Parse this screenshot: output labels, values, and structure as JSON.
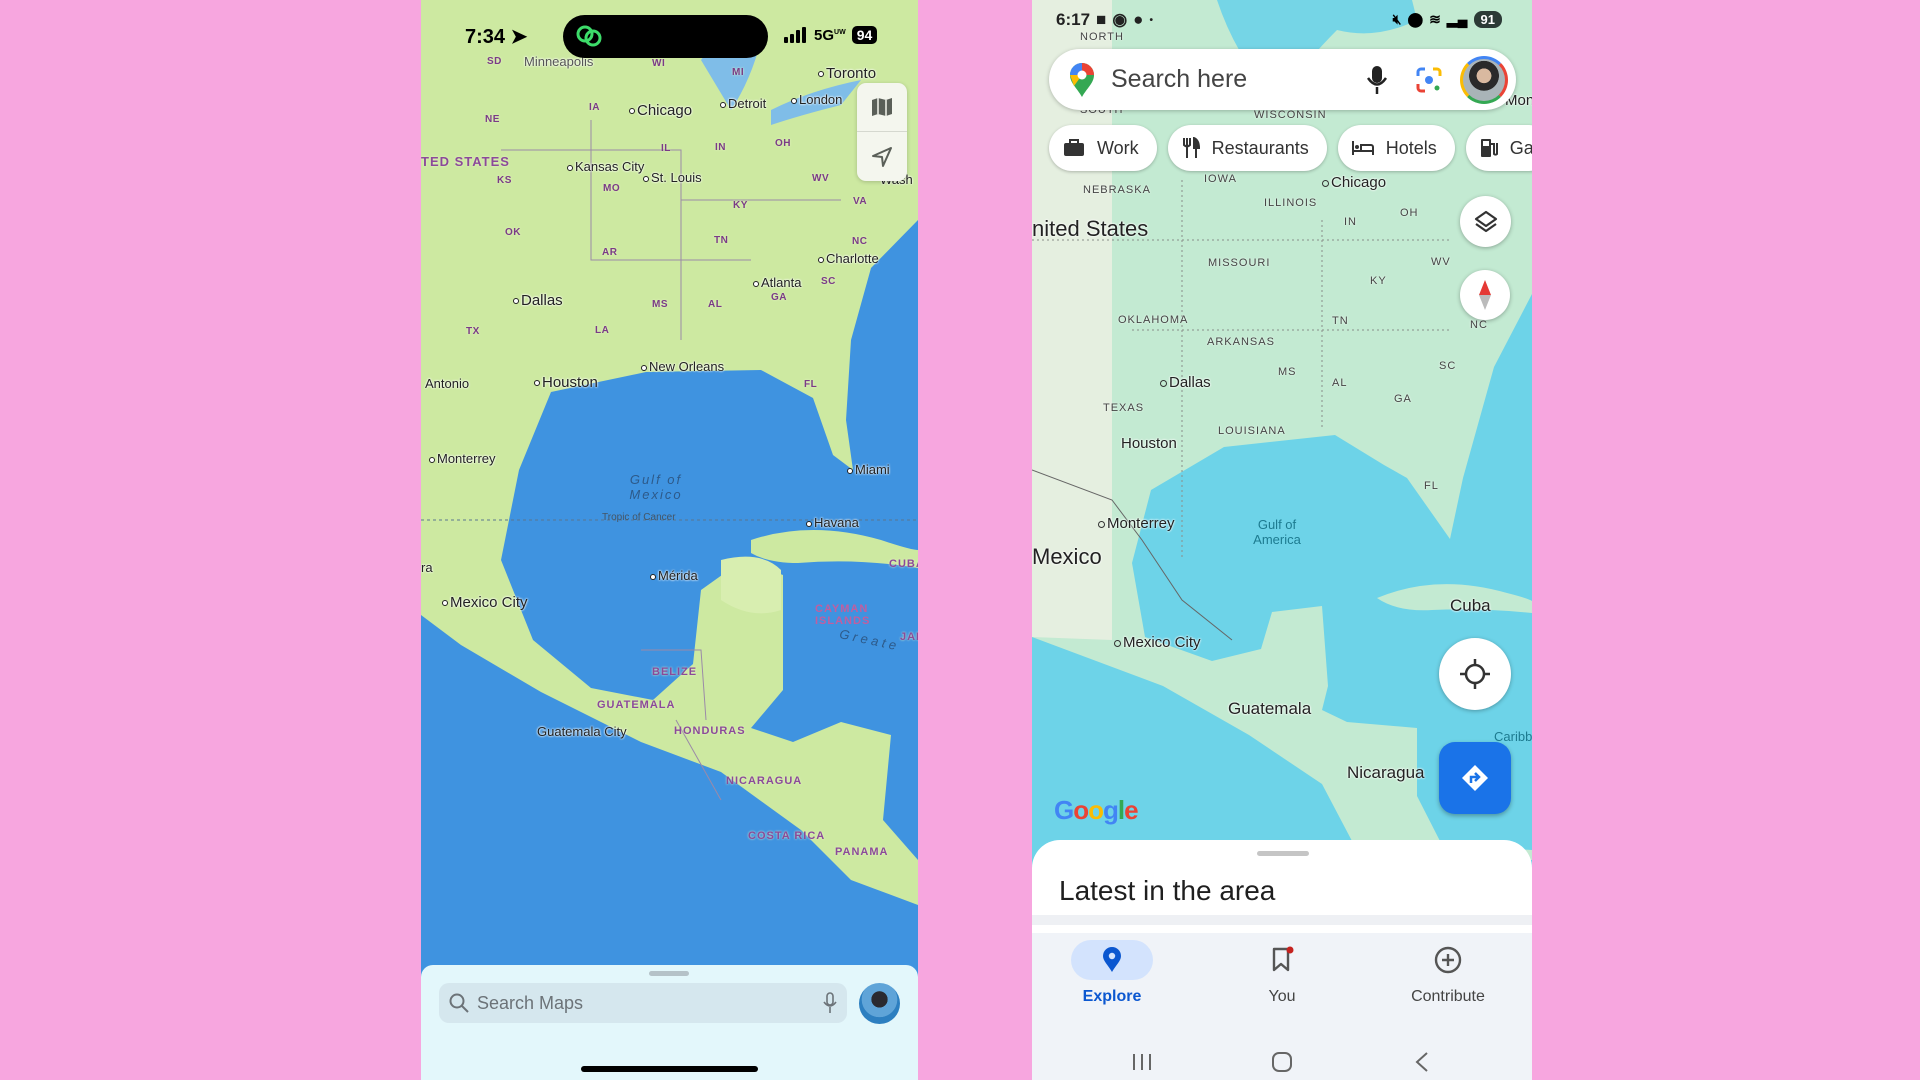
{
  "apple_maps": {
    "status": {
      "time": "7:34",
      "network": "5G",
      "network_suffix": "UW",
      "battery": "94"
    },
    "controls": {
      "map_mode": "map-icon",
      "locate": "location-arrow-icon"
    },
    "labels": {
      "minneapolis": "Minneapolis",
      "sd": "SD",
      "wi": "WI",
      "mi": "MI",
      "toronto": "Toronto",
      "london": "London",
      "detroit": "Detroit",
      "chicago": "Chicago",
      "ia": "IA",
      "ne": "NE",
      "il": "IL",
      "in": "IN",
      "oh": "OH",
      "us": "TED STATES",
      "kansas_city": "Kansas City",
      "st_louis": "St. Louis",
      "ks": "KS",
      "mo": "MO",
      "wv": "WV",
      "wash": "Wash",
      "ky": "KY",
      "va": "VA",
      "ok": "OK",
      "tn": "TN",
      "nc": "NC",
      "charlotte": "Charlotte",
      "ar": "AR",
      "atlanta": "Atlanta",
      "sc": "SC",
      "ga": "GA",
      "dallas": "Dallas",
      "ms": "MS",
      "al": "AL",
      "tx": "TX",
      "la": "LA",
      "new_orleans": "New Orleans",
      "antonio": "Antonio",
      "houston": "Houston",
      "fl": "FL",
      "monterrey": "Monterrey",
      "miami": "Miami",
      "gulf1": "Gulf of",
      "gulf2": "Mexico",
      "tropic": "Tropic of Cancer",
      "havana": "Havana",
      "cuba": "CUBA",
      "ra": "ra",
      "merida": "Mérida",
      "mexico_city": "Mexico City",
      "cayman1": "CAYMAN",
      "cayman2": "ISLANDS",
      "greater": "G r e a t e",
      "jam": "JAM",
      "belize": "BELIZE",
      "guatemala": "GUATEMALA",
      "guatemala_city": "Guatemala City",
      "honduras": "HONDURAS",
      "nicaragua": "NICARAGUA",
      "costa_rica": "COSTA RICA",
      "panama": "PANAMA"
    },
    "search": {
      "placeholder": "Search Maps"
    }
  },
  "google_maps": {
    "status": {
      "time": "6:17",
      "battery": "91"
    },
    "search": {
      "placeholder": "Search here"
    },
    "chips": [
      {
        "label": "Work",
        "icon": "briefcase-icon"
      },
      {
        "label": "Restaurants",
        "icon": "fork-knife-icon"
      },
      {
        "label": "Hotels",
        "icon": "bed-icon"
      },
      {
        "label": "Ga",
        "icon": "gas-pump-icon"
      }
    ],
    "labels": {
      "north": "NORTH",
      "south": "SOUTH",
      "wisconsin": "WISCONSIN",
      "nebraska": "NEBRASKA",
      "iowa": "IOWA",
      "chicago": "Chicago",
      "illinois": "ILLINOIS",
      "in": "IN",
      "oh": "OH",
      "us": "nited States",
      "wv": "WV",
      "missouri": "MISSOURI",
      "ky": "KY",
      "oklahoma": "OKLAHOMA",
      "tn": "TN",
      "nc": "NC",
      "arkansas": "ARKANSAS",
      "sc": "SC",
      "ms": "MS",
      "dallas": "Dallas",
      "al": "AL",
      "ga": "GA",
      "texas": "TEXAS",
      "louisiana": "LOUISIANA",
      "houston": "Houston",
      "fl": "FL",
      "monterrey": "Monterrey",
      "gulf1": "Gulf of",
      "gulf2": "America",
      "mexico": "Mexico",
      "cuba": "Cuba",
      "mexico_city": "Mexico City",
      "guatemala": "Guatemala",
      "caribb": "Caribb",
      "nicaragua": "Nicaragua",
      "mon": "Mon"
    },
    "logo": "Google",
    "sheet": {
      "title": "Latest in the area"
    },
    "nav": [
      {
        "label": "Explore",
        "active": true
      },
      {
        "label": "You",
        "badge": true
      },
      {
        "label": "Contribute"
      }
    ],
    "colors": {
      "accent": "#1a73e8",
      "land": "#c3ead2",
      "water": "#6dd3e8"
    }
  }
}
